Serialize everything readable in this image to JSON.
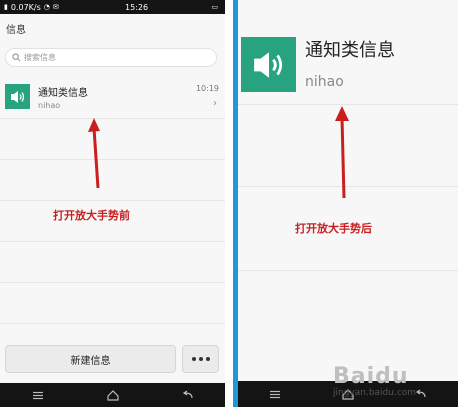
{
  "left": {
    "status": {
      "speed": "0.07K/s",
      "time": "15:26"
    },
    "header_title": "信息",
    "search_placeholder": "搜索信息",
    "message": {
      "title": "通知类信息",
      "preview": "nihao",
      "time": "10:19"
    },
    "caption": "打开放大手势前",
    "new_message_label": "新建信息"
  },
  "right": {
    "message": {
      "title": "通知类信息",
      "preview": "nihao"
    },
    "caption": "打开放大手势后",
    "watermark": "Baidu",
    "watermark_url": "jingyan.baidu.com"
  },
  "colors": {
    "accent_green": "#28a37f",
    "arrow_red": "#c91f1f",
    "border_blue": "#1c9ad6"
  },
  "icons": [
    "speaker-icon",
    "search-icon",
    "chevron-right-icon",
    "menu-icon",
    "home-icon",
    "back-icon",
    "more-dots-icon"
  ]
}
